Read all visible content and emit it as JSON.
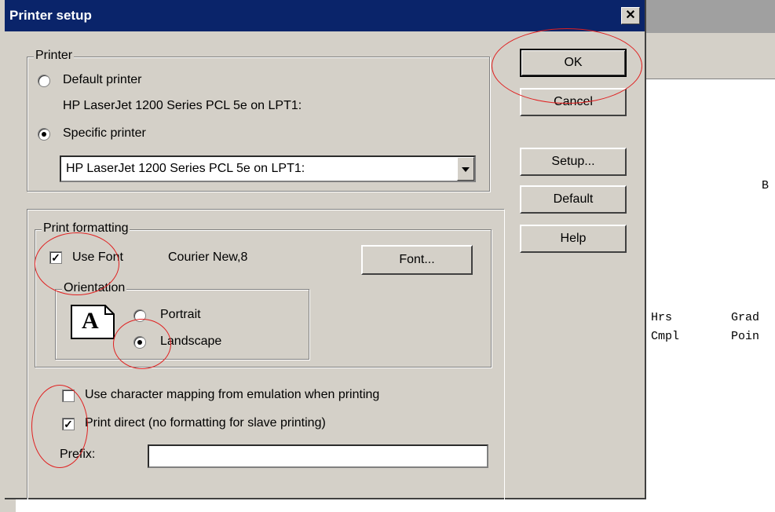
{
  "dialog": {
    "title": "Printer setup",
    "close_glyph": "✕"
  },
  "printer_group": {
    "legend": "Printer",
    "default_label": "Default printer",
    "default_printer_name": "HP LaserJet 1200 Series PCL 5e on LPT1:",
    "specific_label": "Specific printer",
    "specific_selected": true,
    "combo_value": "HP LaserJet 1200 Series PCL 5e on LPT1:"
  },
  "buttons": {
    "ok": "OK",
    "cancel": "Cancel",
    "setup": "Setup...",
    "default": "Default",
    "help": "Help",
    "font": "Font..."
  },
  "format_group": {
    "legend": "Print formatting",
    "use_font_label": "Use Font",
    "use_font_checked": true,
    "font_value": "Courier New,8",
    "orientation_legend": "Orientation",
    "orientation_icon_letter": "A",
    "portrait_label": "Portrait",
    "landscape_label": "Landscape",
    "landscape_selected": true
  },
  "options": {
    "char_mapping_label": "Use character mapping from emulation when printing",
    "char_mapping_checked": false,
    "print_direct_label": "Print direct (no formatting for slave printing)",
    "print_direct_checked": true,
    "prefix_label": "Prefix:",
    "prefix_value": ""
  },
  "background_text": {
    "b": "B",
    "hrs": "Hrs",
    "grad": "Grad",
    "cmpl": "Cmpl",
    "point": "Poin"
  },
  "colors": {
    "title_bar": "#0a246a",
    "dialog_face": "#d4d0c8",
    "annotation": "#e02020"
  }
}
